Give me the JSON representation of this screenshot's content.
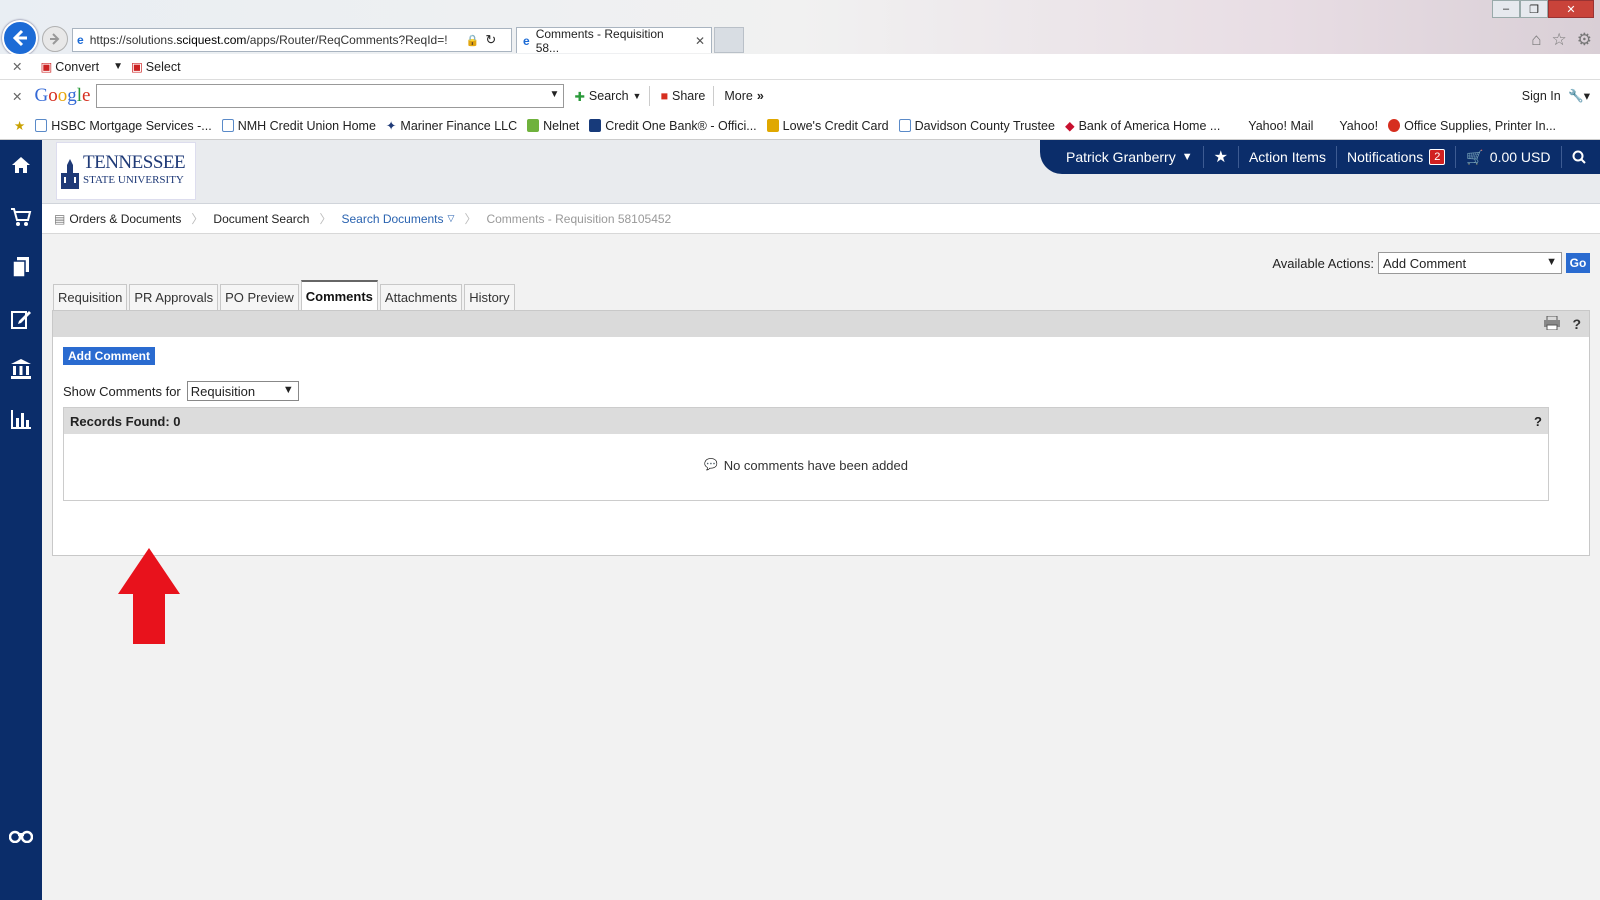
{
  "browser": {
    "url_prefix": "https://solutions.",
    "url_domain": "sciquest.com",
    "url_rest": "/apps/Router/ReqComments?ReqId=!",
    "tab_title": "Comments - Requisition 58...",
    "toolbar1": {
      "convert": "Convert",
      "select": "Select"
    },
    "toolbar2": {
      "google": "Google",
      "search": "Search",
      "share": "Share",
      "more": "More",
      "signin": "Sign In"
    },
    "favorites": [
      "HSBC Mortgage Services -...",
      "NMH Credit Union Home",
      "Mariner Finance LLC",
      "Nelnet",
      "Credit One Bank® - Offici...",
      "Lowe's Credit Card",
      "Davidson County Trustee",
      "Bank of America  Home ...",
      "Yahoo! Mail",
      "Yahoo!",
      "Office Supplies, Printer In..."
    ]
  },
  "header": {
    "logo_line1": "Tennessee",
    "logo_line2": "State University",
    "user": "Patrick Granberry",
    "action_items": "Action Items",
    "notifications": "Notifications",
    "notifications_count": "2",
    "cart": "0.00 USD"
  },
  "breadcrumb": {
    "orders": "Orders & Documents",
    "doc_search": "Document Search",
    "search_docs": "Search Documents",
    "current": "Comments - Requisition 58105452"
  },
  "actions": {
    "label": "Available Actions:",
    "selected": "Add Comment",
    "go": "Go"
  },
  "tabs": [
    "Requisition",
    "PR Approvals",
    "PO Preview",
    "Comments",
    "Attachments",
    "History"
  ],
  "panel": {
    "add_comment": "Add Comment",
    "show_label": "Show Comments for",
    "show_selected": "Requisition",
    "records_found": "Records Found: 0",
    "help": "?",
    "empty_message": "No comments have been added"
  },
  "colors": {
    "sidebar": "#0b2d6a",
    "button": "#2a6bd0",
    "arrow": "#e8121c"
  }
}
